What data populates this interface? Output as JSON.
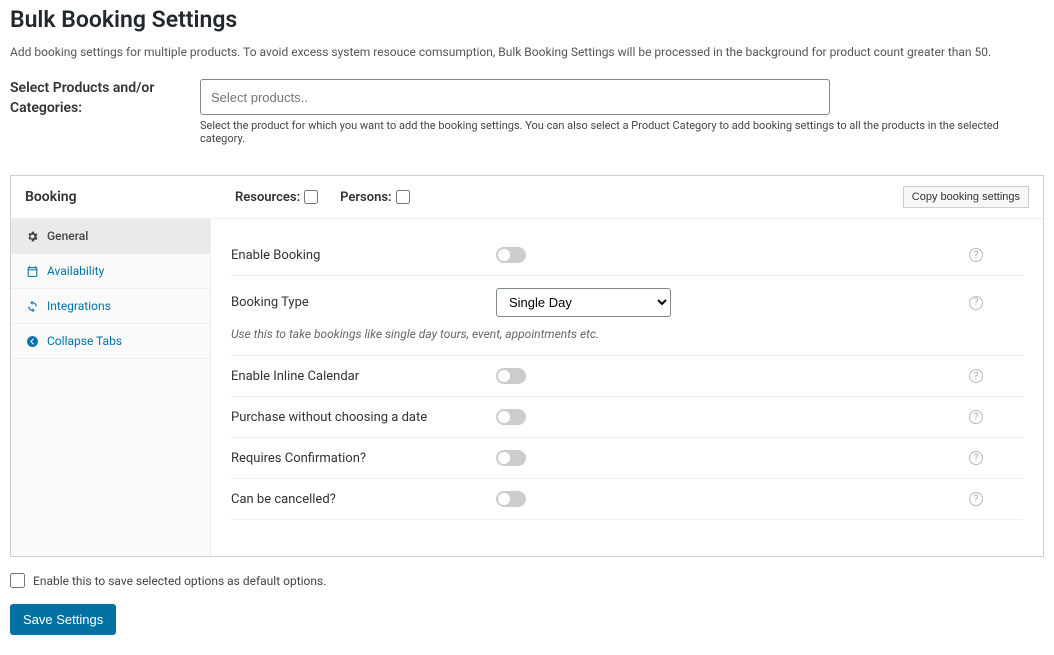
{
  "header": {
    "title": "Bulk Booking Settings",
    "intro": "Add booking settings for multiple products. To avoid excess system resouce comsumption, Bulk Booking Settings will be processed in the background for product count greater than 50."
  },
  "select": {
    "label": "Select Products and/or Categories:",
    "placeholder": "Select products..",
    "help": "Select the product for which you want to add the booking settings. You can also select a Product Category to add booking settings to all the products in the selected category."
  },
  "panel": {
    "title": "Booking",
    "resources_label": "Resources:",
    "persons_label": "Persons:",
    "copy_btn": "Copy booking settings"
  },
  "tabs": {
    "general": "General",
    "availability": "Availability",
    "integrations": "Integrations",
    "collapse": "Collapse Tabs"
  },
  "fields": {
    "enable_booking": "Enable Booking",
    "booking_type": "Booking Type",
    "booking_type_value": "Single Day",
    "booking_type_hint": "Use this to take bookings like single day tours, event, appointments etc.",
    "inline_calendar": "Enable Inline Calendar",
    "purchase_wo_date": "Purchase without choosing a date",
    "requires_confirmation": "Requires Confirmation?",
    "can_be_cancelled": "Can be cancelled?"
  },
  "footer": {
    "default_opt": "Enable this to save selected options as default options.",
    "save_btn": "Save Settings"
  }
}
